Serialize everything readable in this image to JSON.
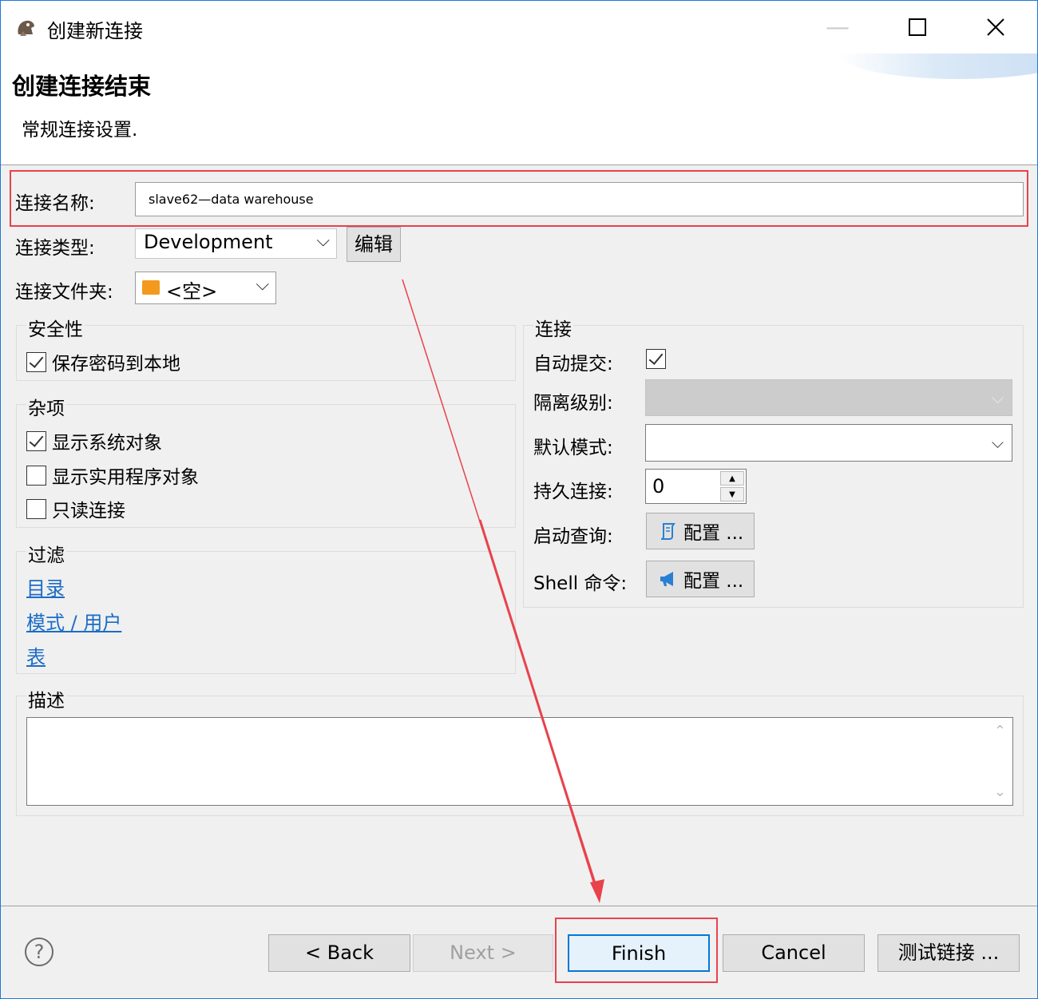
{
  "window": {
    "title": "创建新连接",
    "controls": {
      "minimize": "—",
      "maximize": "☐",
      "close": "✕"
    }
  },
  "header": {
    "title": "创建连接结束",
    "description": "常规连接设置."
  },
  "form": {
    "name_label": "连接名称:",
    "name_value": "slave62—data warehouse",
    "type_label": "连接类型:",
    "type_value": "Development",
    "edit_button": "编辑",
    "folder_label": "连接文件夹:",
    "folder_value": "<空>"
  },
  "security": {
    "title": "安全性",
    "save_password": {
      "label": "保存密码到本地",
      "checked": true
    }
  },
  "misc": {
    "title": "杂项",
    "items": [
      {
        "label": "显示系统对象",
        "checked": true
      },
      {
        "label": "显示实用程序对象",
        "checked": false
      },
      {
        "label": "只读连接",
        "checked": false
      }
    ]
  },
  "filter": {
    "title": "过滤",
    "links": [
      "目录",
      "模式 / 用户",
      "表"
    ]
  },
  "connection": {
    "title": "连接",
    "auto_commit_label": "自动提交:",
    "auto_commit_checked": true,
    "isolation_label": "隔离级别:",
    "isolation_value": "",
    "default_schema_label": "默认模式:",
    "default_schema_value": "",
    "keep_alive_label": "持久连接:",
    "keep_alive_value": "0",
    "bootstrap_label": "启动查询:",
    "bootstrap_button": "配置 ...",
    "shell_label": "Shell 命令:",
    "shell_button": "配置 ..."
  },
  "description_group": {
    "title": "描述",
    "value": ""
  },
  "footer": {
    "help": "?",
    "back": "< Back",
    "next": "Next >",
    "finish": "Finish",
    "cancel": "Cancel",
    "test": "测试链接 ..."
  },
  "colors": {
    "highlight": "#e8424b",
    "link": "#1a6dc7",
    "accent": "#0078d7"
  }
}
